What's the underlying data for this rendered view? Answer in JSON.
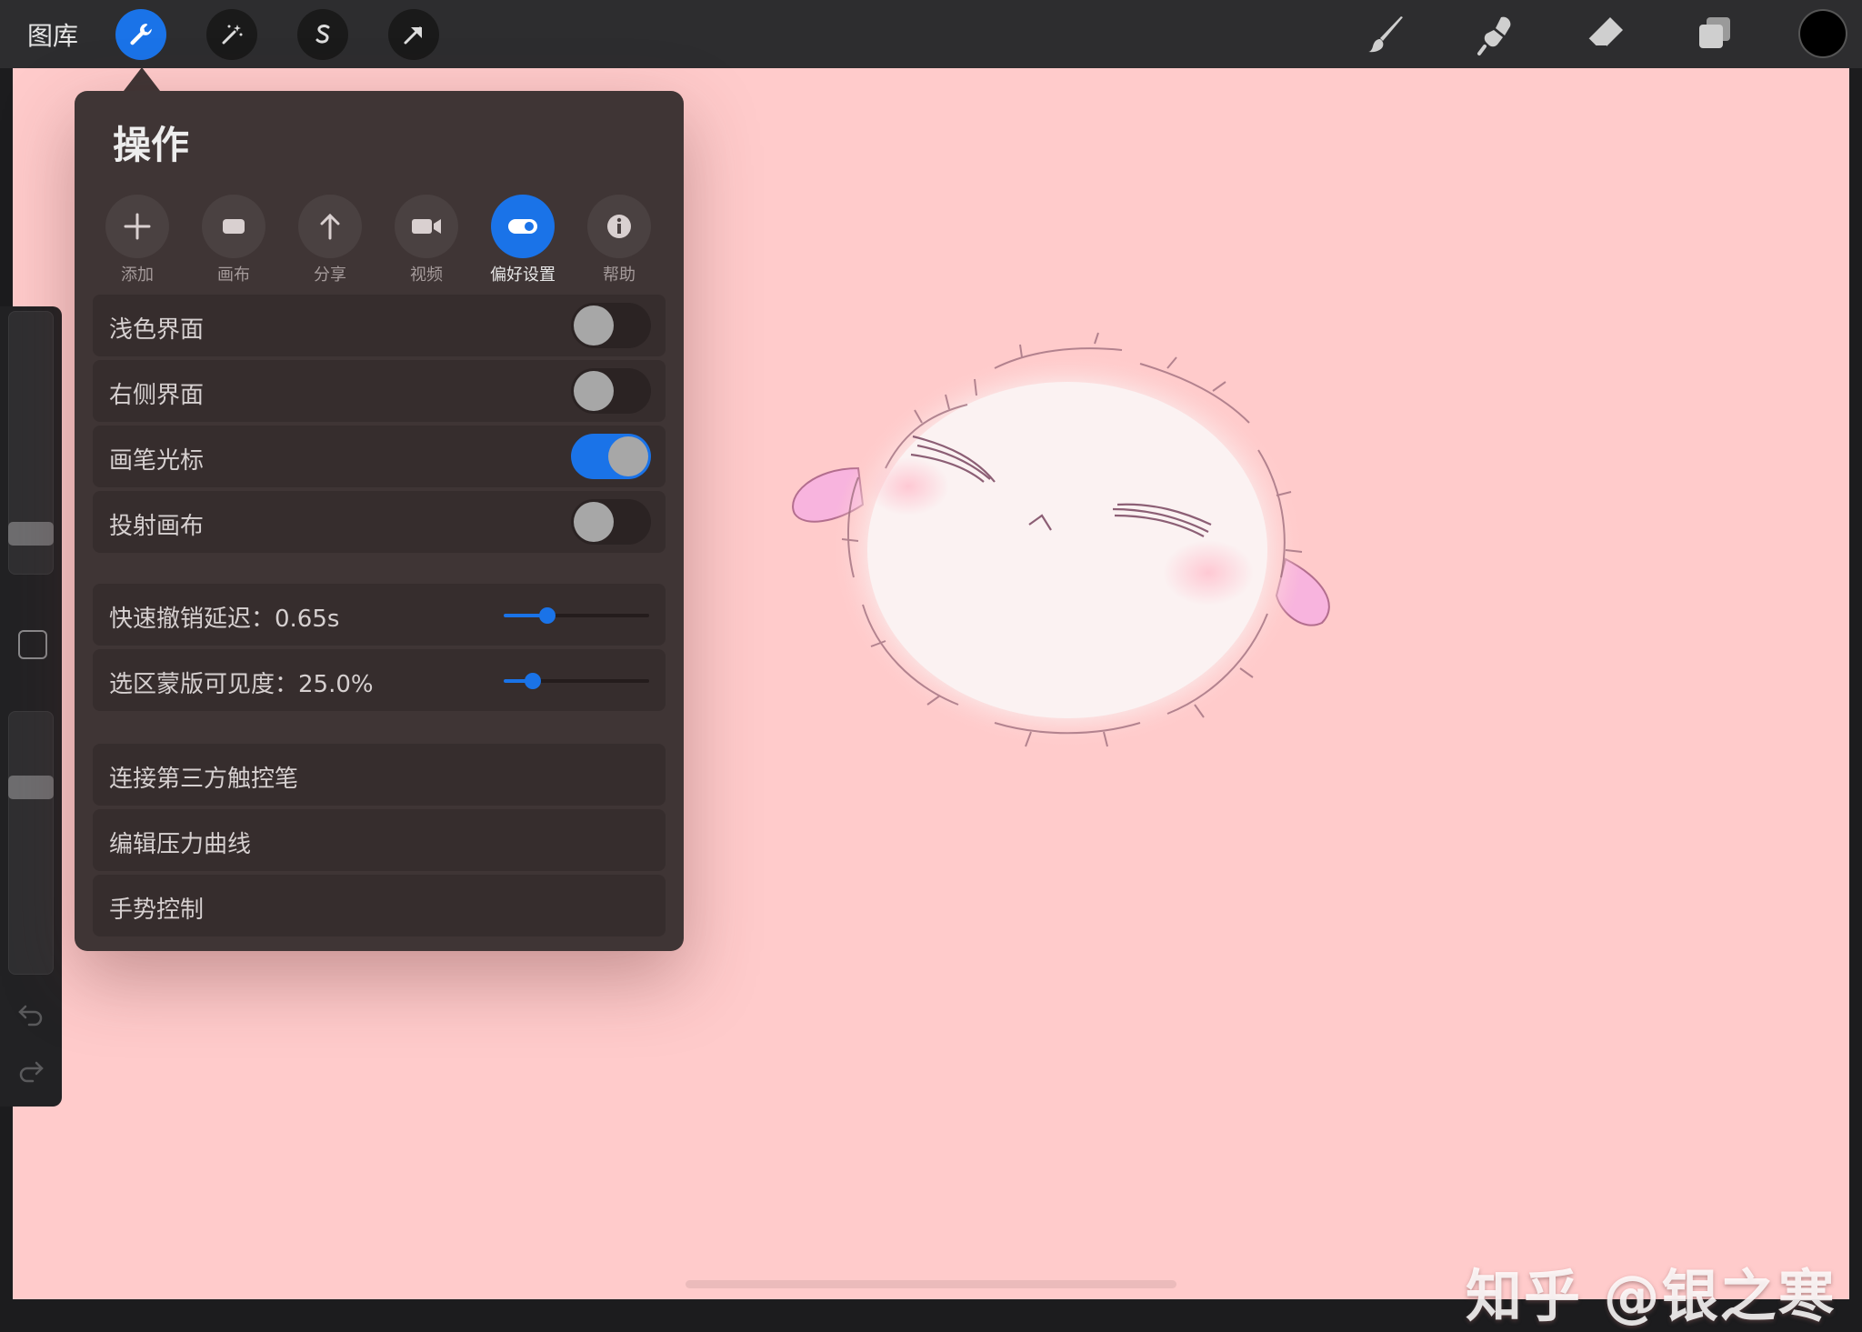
{
  "topbar": {
    "gallery_label": "图库",
    "left_buttons": [
      "wrench-icon",
      "magic-wand-icon",
      "adjust-s-icon",
      "transform-arrow-icon"
    ],
    "right_tools": [
      "brush-icon",
      "smudge-icon",
      "eraser-icon",
      "layers-icon",
      "color-swatch"
    ],
    "active_color": "#000000",
    "accent": "#1a73e8"
  },
  "panel": {
    "title": "操作",
    "tabs": [
      {
        "label": "添加",
        "icon": "plus-icon"
      },
      {
        "label": "画布",
        "icon": "canvas-icon"
      },
      {
        "label": "分享",
        "icon": "share-arrow-icon"
      },
      {
        "label": "视频",
        "icon": "video-camera-icon"
      },
      {
        "label": "偏好设置",
        "icon": "toggle-icon",
        "active": true
      },
      {
        "label": "帮助",
        "icon": "info-icon"
      }
    ],
    "toggles": [
      {
        "label": "浅色界面",
        "on": false
      },
      {
        "label": "右侧界面",
        "on": false
      },
      {
        "label": "画笔光标",
        "on": true
      },
      {
        "label": "投射画布",
        "on": false
      }
    ],
    "sliders": [
      {
        "label": "快速撤销延迟：0.65s",
        "fraction": 0.3
      },
      {
        "label": "选区蒙版可见度：25.0%",
        "fraction": 0.2
      }
    ],
    "links": [
      "连接第三方触控笔",
      "编辑压力曲线",
      "手势控制"
    ]
  },
  "sidebar": {
    "brush_size_level": 0.12,
    "opacity_level": 0.73
  },
  "canvas": {
    "background": "#ffcbcb",
    "watermark": "知乎 @银之寒"
  }
}
